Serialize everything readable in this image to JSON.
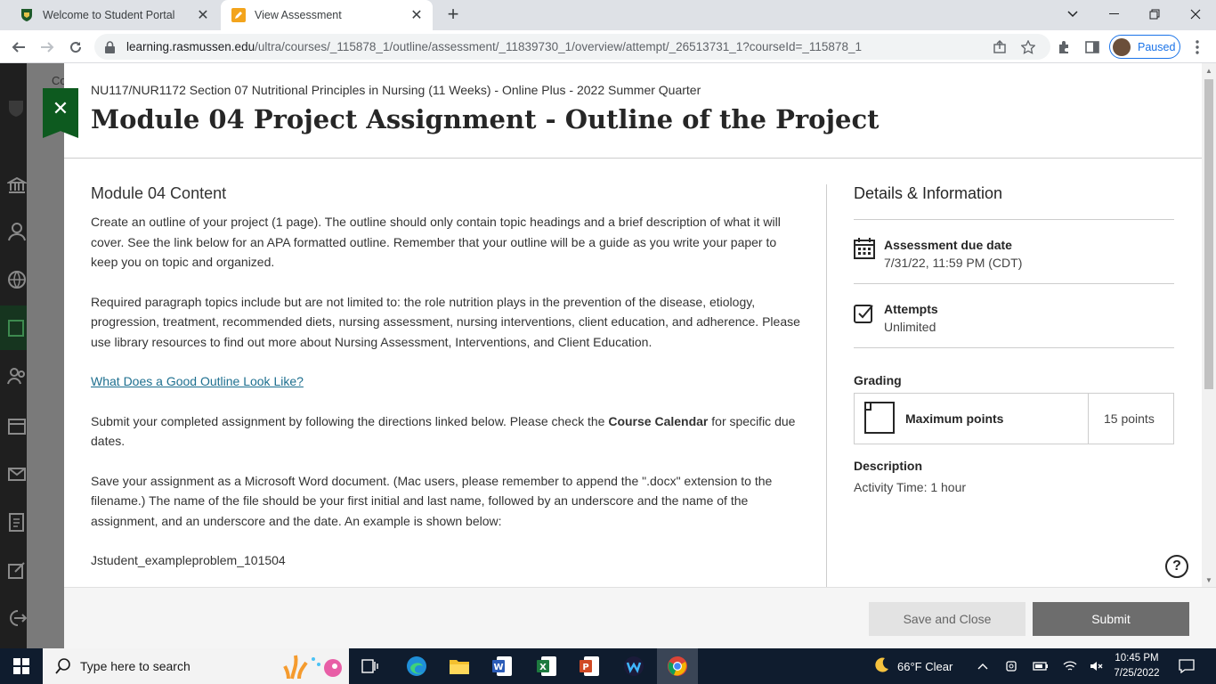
{
  "browser": {
    "tabs": [
      {
        "title": "Welcome to Student Portal",
        "active": false
      },
      {
        "title": "View Assessment",
        "active": true
      }
    ],
    "url_host": "learning.rasmussen.edu",
    "url_path": "/ultra/courses/_115878_1/outline/assessment/_11839730_1/overview/attempt/_26513731_1?courseId=_115878_1",
    "profile_status": "Paused"
  },
  "background": {
    "course_text": "Co"
  },
  "assessment": {
    "course": "NU117/NUR1172 Section 07 Nutritional Principles in Nursing (11 Weeks) - Online Plus - 2022 Summer Quarter",
    "title": "Module 04 Project Assignment - Outline of the Project",
    "content_heading": "Module 04 Content",
    "para1": "Create an outline of your project (1 page). The outline should only contain topic headings and a brief description of what it will cover. See the link below for an APA formatted outline. Remember that your outline will be a guide as you write your paper to keep you on topic and organized.",
    "para2": "Required paragraph topics include but are not limited to: the role nutrition plays in the prevention of the disease, etiology, progression, treatment, recommended diets, nursing assessment, nursing interventions, client education, and adherence. Please use library resources to find out more about Nursing Assessment, Interventions, and Client Education.",
    "link": "What Does a Good Outline Look Like?",
    "para3_before": "Submit your completed assignment by following the directions linked below. Please check the ",
    "para3_bold": "Course Calendar",
    "para3_after": " for specific due dates.",
    "para4": "Save your assignment as a Microsoft Word document. (Mac users, please remember to append the \".docx\" extension to the filename.) The name of the file should be your first initial and last name, followed by an underscore and the name of the assignment, and an underscore and the date. An example is shown below:",
    "example": "Jstudent_exampleproblem_101504"
  },
  "details": {
    "heading": "Details & Information",
    "due_label": "Assessment due date",
    "due_value": "7/31/22, 11:59 PM (CDT)",
    "attempts_label": "Attempts",
    "attempts_value": "Unlimited",
    "grading_label": "Grading",
    "max_points_label": "Maximum points",
    "max_points_value": "15 points",
    "description_label": "Description",
    "description_value": "Activity Time: 1 hour"
  },
  "footer": {
    "save_label": "Save and Close",
    "submit_label": "Submit"
  },
  "taskbar": {
    "search_placeholder": "Type here to search",
    "weather": "66°F  Clear",
    "time": "10:45 PM",
    "date": "7/25/2022"
  }
}
